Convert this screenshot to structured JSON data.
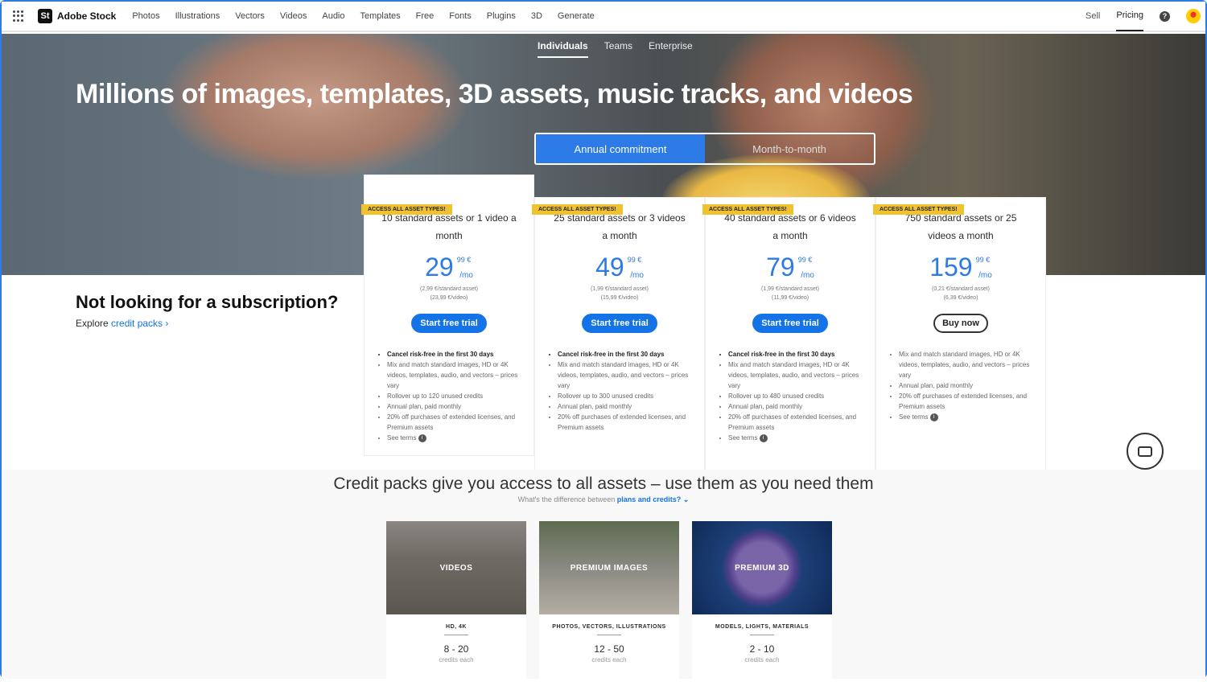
{
  "topnav": {
    "brand": "Adobe Stock",
    "logo": "St",
    "items": [
      "Photos",
      "Illustrations",
      "Vectors",
      "Videos",
      "Audio",
      "Templates",
      "Free",
      "Fonts",
      "Plugins",
      "3D",
      "Generate"
    ],
    "sell": "Sell",
    "pricing": "Pricing"
  },
  "subnav": [
    "Individuals",
    "Teams",
    "Enterprise"
  ],
  "hero": {
    "headline": "Millions of images, templates, 3D assets, music tracks, and videos",
    "toggle": [
      "Annual commitment",
      "Month-to-month"
    ]
  },
  "plans": [
    {
      "ribbon": "ACCESS ALL ASSET TYPES!",
      "desc": "10 standard assets or 1 video a month",
      "price": "29",
      "cents": "99 €",
      "per": "/mo",
      "unit1": "(2,99 €/standard asset)",
      "unit2": "(23,99 €/video)",
      "button": "Start free trial",
      "features": [
        "Cancel risk-free in the first 30 days",
        "Mix and match standard images, HD or 4K videos, templates, audio, and vectors – prices vary",
        "Rollover up to 120 unused credits",
        "Annual plan, paid monthly",
        "20% off purchases of extended licenses, and Premium assets",
        "See terms"
      ]
    },
    {
      "ribbon": "ACCESS ALL ASSET TYPES!",
      "desc": "25 standard assets or 3 videos a month",
      "price": "49",
      "cents": "99 €",
      "per": "/mo",
      "unit1": "(1,99 €/standard asset)",
      "unit2": "(15,99 €/video)",
      "button": "Start free trial",
      "features": [
        "Cancel risk-free in the first 30 days",
        "Mix and match standard images, HD or 4K videos, templates, audio, and vectors – prices vary",
        "Rollover up to 300 unused credits",
        "Annual plan, paid monthly",
        "20% off purchases of extended licenses, and Premium assets"
      ]
    },
    {
      "ribbon": "ACCESS ALL ASSET TYPES!",
      "desc": "40 standard assets or 6 videos a month",
      "price": "79",
      "cents": "99 €",
      "per": "/mo",
      "unit1": "(1,99 €/standard asset)",
      "unit2": "(11,99 €/video)",
      "button": "Start free trial",
      "features": [
        "Cancel risk-free in the first 30 days",
        "Mix and match standard images, HD or 4K videos, templates, audio, and vectors – prices vary",
        "Rollover up to 480 unused credits",
        "Annual plan, paid monthly",
        "20% off purchases of extended licenses, and Premium assets",
        "See terms"
      ]
    },
    {
      "ribbon": "ACCESS ALL ASSET TYPES!",
      "desc": "750 standard assets or 25 videos a month",
      "price": "159",
      "cents": "99 €",
      "per": "/mo",
      "unit1": "(0,21 €/standard asset)",
      "unit2": "(6,39 €/video)",
      "button": "Buy now",
      "features": [
        "Mix and match standard images, HD or 4K videos, templates, audio, and vectors – prices vary",
        "Annual plan, paid monthly",
        "20% off purchases of extended licenses, and Premium assets",
        "See terms"
      ]
    }
  ],
  "alt": {
    "title": "Not looking for a subscription?",
    "explore": "Explore ",
    "link": "credit packs ›"
  },
  "credits": {
    "title": "Credit packs give you access to all assets – use them as you need them",
    "sub": "What's the difference between ",
    "sublink": "plans and credits? ⌄",
    "packs": [
      {
        "label": "VIDEOS",
        "cat": "HD, 4K",
        "range": "8 - 20",
        "each": "credits each"
      },
      {
        "label": "PREMIUM IMAGES",
        "cat": "PHOTOS, VECTORS, ILLUSTRATIONS",
        "range": "12 - 50",
        "each": "credits each"
      },
      {
        "label": "PREMIUM 3D",
        "cat": "MODELS, LIGHTS, MATERIALS",
        "range": "2 - 10",
        "each": "credits each"
      }
    ]
  }
}
